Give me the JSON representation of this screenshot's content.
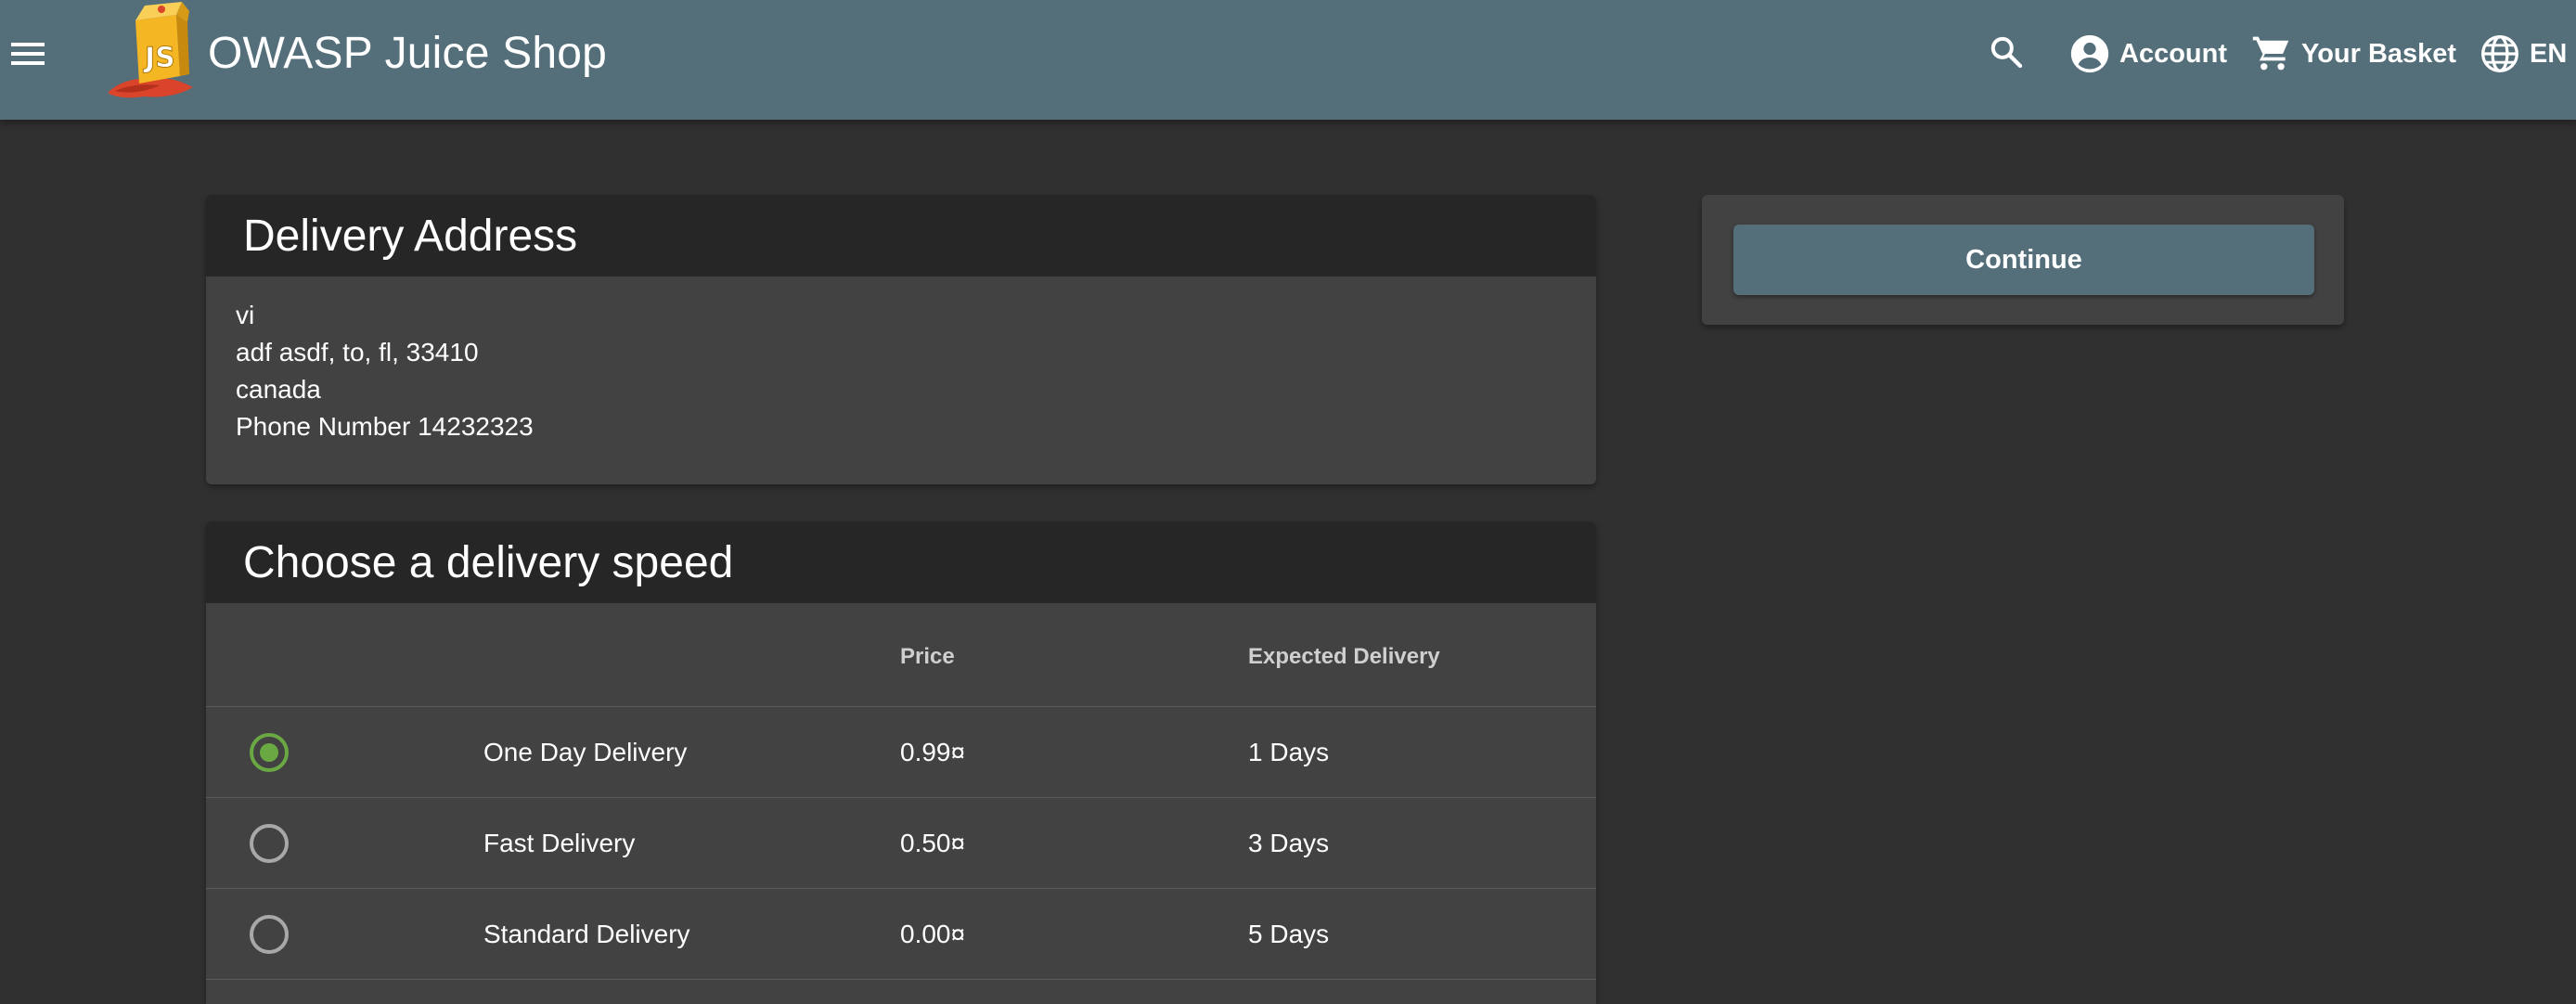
{
  "header": {
    "title": "OWASP Juice Shop",
    "menu_icon": "menu-icon",
    "search_icon": "search-icon",
    "account_label": "Account",
    "basket_label": "Your Basket",
    "language_label": "EN",
    "bar_color": "#546e7a"
  },
  "address": {
    "title": "Delivery Address",
    "name": "vi",
    "street": "adf asdf, to, fl, 33410",
    "country": "canada",
    "phone": "Phone Number 14232323"
  },
  "delivery": {
    "title": "Choose a delivery speed",
    "columns": {
      "price": "Price",
      "expected": "Expected Delivery"
    },
    "options": [
      {
        "name": "One Day Delivery",
        "price": "0.99¤",
        "eta": "1 Days",
        "selected": true
      },
      {
        "name": "Fast Delivery",
        "price": "0.50¤",
        "eta": "3 Days",
        "selected": false
      },
      {
        "name": "Standard Delivery",
        "price": "0.00¤",
        "eta": "5 Days",
        "selected": false
      }
    ],
    "accent_color": "#69a843"
  },
  "actions": {
    "continue_label": "Continue"
  }
}
